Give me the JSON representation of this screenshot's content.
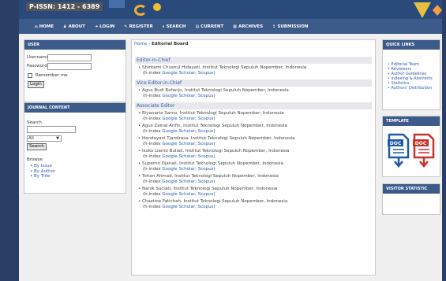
{
  "banner": {
    "issn": "P-ISSN: 1412 - 6389"
  },
  "nav": [
    {
      "icon": "⌂",
      "label": "HOME"
    },
    {
      "icon": "♟",
      "label": "ABOUT"
    },
    {
      "icon": "➜",
      "label": "LOGIN"
    },
    {
      "icon": "✎",
      "label": "REGISTER"
    },
    {
      "icon": "⌕",
      "label": "SEARCH"
    },
    {
      "icon": "▤",
      "label": "CURRENT"
    },
    {
      "icon": "▦",
      "label": "ARCHIVES"
    },
    {
      "icon": "⇪",
      "label": "SUBMISSION"
    }
  ],
  "user": {
    "title": "USER",
    "username_label": "Username",
    "password_label": "Password",
    "remember_label": "Remember me",
    "login_label": "Login"
  },
  "journal": {
    "title": "JOURNAL CONTENT",
    "search_label": "Search",
    "scope_value": "All",
    "search_button": "Search",
    "browse_label": "Browse",
    "browse_items": [
      "By Issue",
      "By Author",
      "By Title"
    ]
  },
  "breadcrumb": {
    "home": "Home",
    "sep": "›",
    "current": "Editorial Board"
  },
  "board": {
    "hindex": "(h-index",
    "sections": [
      {
        "title": "Editor-in-Chief",
        "people": [
          {
            "name": "Shintami Chusnul Hidayati, Institut Teknologi Sepuluh Nopember, Indonesia",
            "scholar": "Google Scholar",
            "scopus": "Scopus"
          }
        ]
      },
      {
        "title": "Vice Editor-in-Chief",
        "people": [
          {
            "name": "Agus Budi Raharjo, Institut Teknologi Sepuluh Nopember, Indonesia",
            "scholar": "Google Scholar",
            "scopus": "Scopus"
          }
        ]
      },
      {
        "title": "Associate Editor",
        "people": [
          {
            "name": "Riyanarto Sarno, Institut Teknologi Sepuluh Nopember, Indonesia",
            "scholar": "Google Scholar",
            "scopus": "Scopus"
          },
          {
            "name": "Agus Zainal Arifin, Institut Teknologi Sepuluh Nopember, Indonesia",
            "scholar": "Google Scholar",
            "scopus": "Scopus"
          },
          {
            "name": "Handayani Tjandrasa, Institut Teknologi Sepuluh Nopember, Indonesia",
            "scholar": "Google Scholar",
            "scopus": "Scopus"
          },
          {
            "name": "Isoko Lianto Buliali, Institut Teknologi Sepuluh Nopember, Indonesia",
            "scholar": "Google Scholar",
            "scopus": "Scopus"
          },
          {
            "name": "Superno Djanali, Institut Teknologi Sepuluh Nopember, Indonesia",
            "scholar": "Google Scholar",
            "scopus": "Scopus"
          },
          {
            "name": "Tohari Ahmad, Institut Teknologi Sepuluh Nopember, Indonesia",
            "scholar": "Google Scholar",
            "scopus": "Scopus"
          },
          {
            "name": "Nanik Suciati, Institut Teknologi Sepuluh Nopember, Indonesia",
            "scholar": "Google Scholar",
            "scopus": "Scopus"
          },
          {
            "name": "Chastine Fatichah, Institut Teknologi Sepuluh Nopember, Indonesia",
            "scholar": "Google Scholar",
            "scopus": "Scopus"
          }
        ]
      }
    ]
  },
  "quick_links": {
    "title": "QUICK LINKS",
    "items": [
      "Editorial Team",
      "Reviewers",
      "Author Guidelines",
      "Indexing & Abstracts",
      "Statistics",
      "Authors' Distribution"
    ]
  },
  "template": {
    "title": "TEMPLATE",
    "icons": [
      "DOC",
      "DOC"
    ]
  },
  "visitor": {
    "title": "VISITOR STATISTIC"
  },
  "colors": {
    "nav": "#3c5a8a",
    "link": "#2a5db0",
    "doc_blue": "#1f5aa8",
    "doc_red": "#c8332a"
  }
}
